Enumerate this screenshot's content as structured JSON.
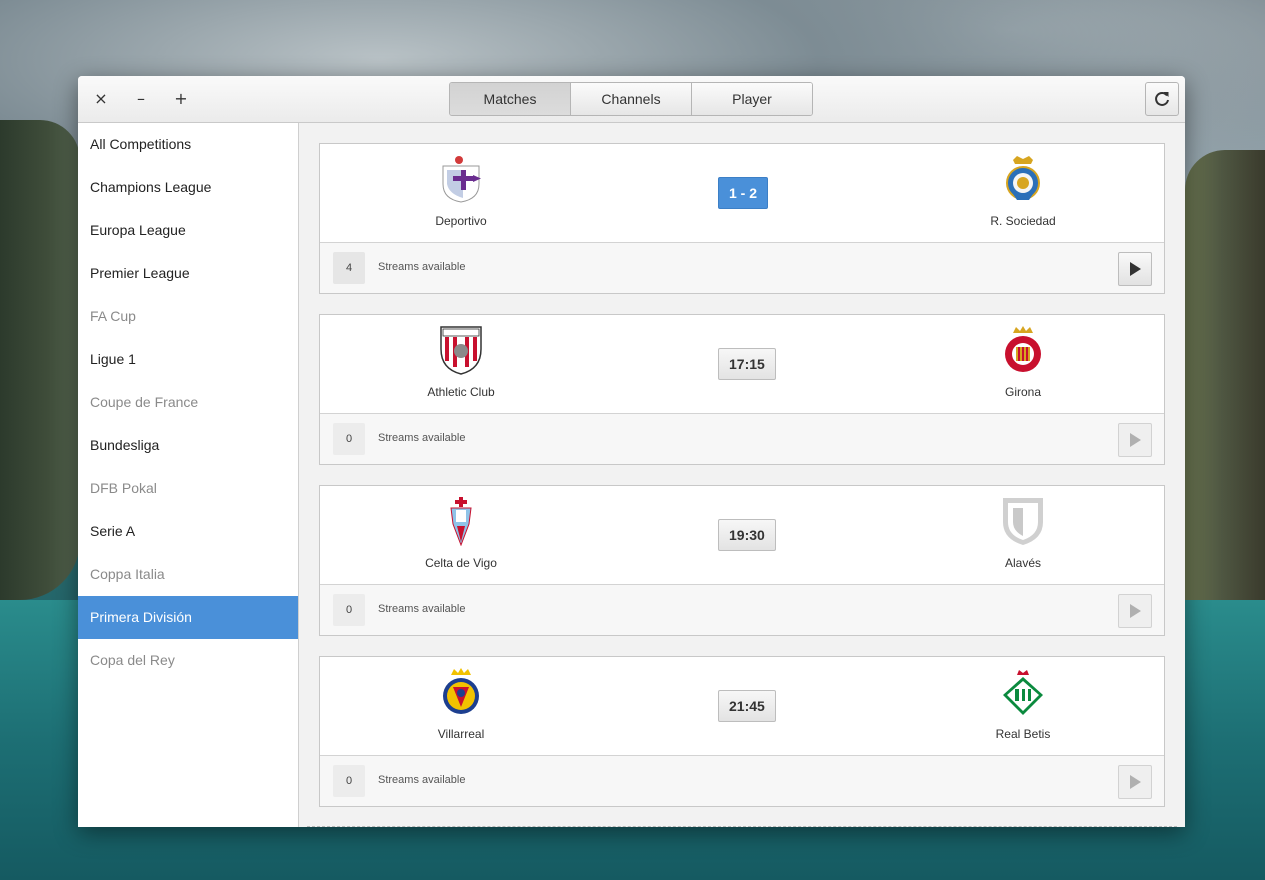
{
  "window_controls": {
    "close": "×",
    "minimize": "–",
    "maximize": "+"
  },
  "tabs": [
    {
      "label": "Matches",
      "active": true
    },
    {
      "label": "Channels",
      "active": false
    },
    {
      "label": "Player",
      "active": false
    }
  ],
  "refresh_icon": "refresh-icon",
  "sidebar": {
    "items": [
      {
        "label": "All Competitions",
        "state": "normal"
      },
      {
        "label": "Champions League",
        "state": "normal"
      },
      {
        "label": "Europa League",
        "state": "normal"
      },
      {
        "label": "Premier League",
        "state": "normal"
      },
      {
        "label": "FA Cup",
        "state": "dim"
      },
      {
        "label": "Ligue 1",
        "state": "normal"
      },
      {
        "label": "Coupe de France",
        "state": "dim"
      },
      {
        "label": "Bundesliga",
        "state": "normal"
      },
      {
        "label": "DFB Pokal",
        "state": "dim"
      },
      {
        "label": "Serie A",
        "state": "normal"
      },
      {
        "label": "Coppa Italia",
        "state": "dim"
      },
      {
        "label": "Primera División",
        "state": "selected"
      },
      {
        "label": "Copa del Rey",
        "state": "dim"
      }
    ]
  },
  "matches": [
    {
      "home": "Deportivo",
      "away": "R. Sociedad",
      "score": "1 - 2",
      "live": true,
      "streams_count": "4",
      "streams_label": "Streams available"
    },
    {
      "home": "Athletic Club",
      "away": "Girona",
      "score": "17:15",
      "live": false,
      "streams_count": "0",
      "streams_label": "Streams available"
    },
    {
      "home": "Celta de Vigo",
      "away": "Alavés",
      "score": "19:30",
      "live": false,
      "streams_count": "0",
      "streams_label": "Streams available"
    },
    {
      "home": "Villarreal",
      "away": "Real Betis",
      "score": "21:45",
      "live": false,
      "streams_count": "0",
      "streams_label": "Streams available"
    }
  ],
  "colors": {
    "accent": "#4a90d9",
    "window_bg": "#f5f5f5",
    "sidebar_bg": "#ffffff"
  }
}
